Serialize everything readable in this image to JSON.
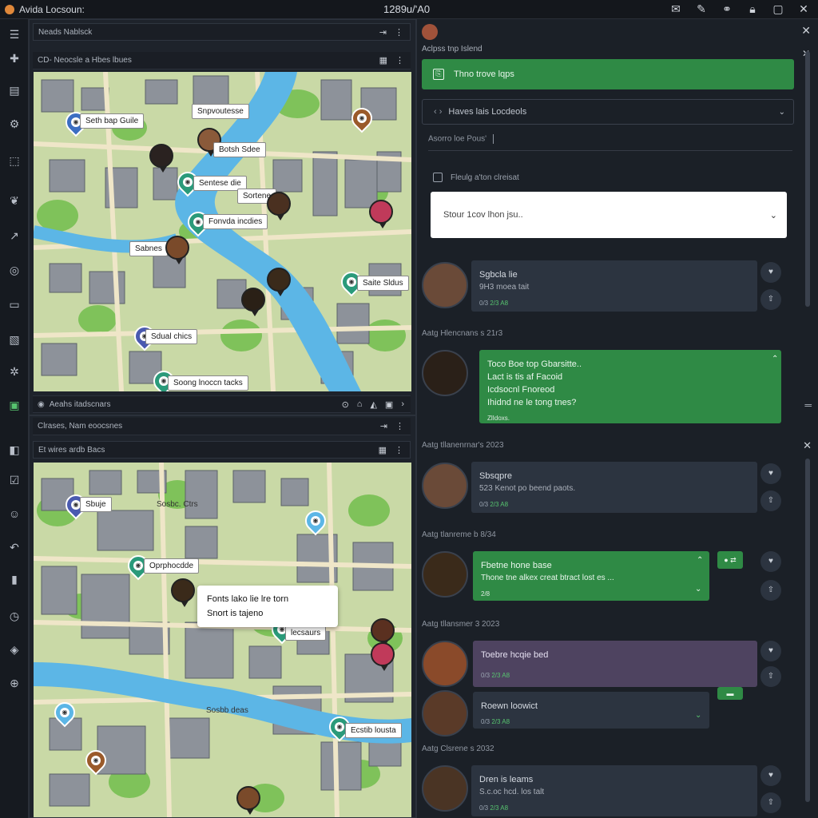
{
  "window": {
    "title": "Avida Locsoun:",
    "center_text": "1289u/'A0",
    "controls": [
      "mail-icon",
      "pen-icon",
      "link-icon",
      "lock-icon",
      "maximize-icon",
      "close-icon"
    ]
  },
  "top_map": {
    "tab_label": "Neads Nablsck",
    "header": "CD- Neocsle a Hbes lbues",
    "labels": [
      "Seth bap Guile",
      "Snpvoutesse",
      "Botsh Sdee",
      "Sentese die",
      "Sortene",
      "Fonvda incdies",
      "Sabnes",
      "Saite Sldus",
      "Sdual chics",
      "Soong lnoccn tacks"
    ],
    "footer": "Aeahs itadscnars",
    "colors": {
      "water": "#5cb6e6",
      "park": "#7fc25a",
      "ground": "#c9d9a6",
      "building": "#8d929a"
    }
  },
  "bottom_map": {
    "tab_label": "Clrases, Nam eoocsnes",
    "header": "Et wires ardb Bacs",
    "labels": [
      "Sbuje",
      "Oprphocdde",
      "Sosbc. Ctrs",
      "lecsaurs",
      "Sosbb deas",
      "Ecstib lousta"
    ],
    "popup": {
      "line1": "Fonts lako lie lre torn",
      "line2": "Snort is tajeno"
    }
  },
  "right_panel": {
    "subtitle": "Aclpss tnp Islend",
    "primary_button": "Thno trove lqps",
    "dropdown": "Haves lais Locdeols",
    "field_placeholder": "Asorro loe Pous'",
    "checkbox_label": "Fleulg a'ton clreisat",
    "search_placeholder": "Stour 1cov lhon jsu..",
    "messages": [
      {
        "name": "Sgbcla lie",
        "text": "9H3 moea tait",
        "meta_a": "0/3",
        "meta_b": "2/3 A8",
        "style": "dark"
      },
      {
        "date": "Aatg Hlencnans s 21r3"
      },
      {
        "name": "Toco Boe top Gbarsitte..",
        "lines": [
          "Lact is tis af Facoid",
          "Icdsocnl Fnoreod",
          "Ihidnd ne le tong tnes?"
        ],
        "meta_b": "ZlIdoxs.",
        "style": "green"
      },
      {
        "date": "Aatg tllanenrnar's 2023"
      },
      {
        "name": "Sbsqpre",
        "text": "523 Kenot po beend paots.",
        "meta_a": "0/3",
        "meta_b": "2/3 A8",
        "style": "dark"
      },
      {
        "date": "Aatg tlanreme b 8/34"
      },
      {
        "name": "Fbetne hone base",
        "text": "Thone tne alkex creat btract lost es ...",
        "meta_b": "2/8",
        "style": "green"
      },
      {
        "date": "Aatg tllansmer 3 2023"
      },
      {
        "name": "Toebre hcqie bed",
        "meta_a": "0/3",
        "meta_b": "2/3 A8",
        "style": "purple"
      },
      {
        "name": "Roewn loowict",
        "meta_a": "0/3",
        "meta_b": "2/3 A8",
        "style": "dark"
      },
      {
        "date": "Aatg Clsrene s 2032"
      },
      {
        "name": "Dren is leams",
        "text": "S.c.oc hcd. los talt",
        "meta_a": "0/3",
        "meta_b": "2/3 A8",
        "style": "dark"
      }
    ]
  }
}
